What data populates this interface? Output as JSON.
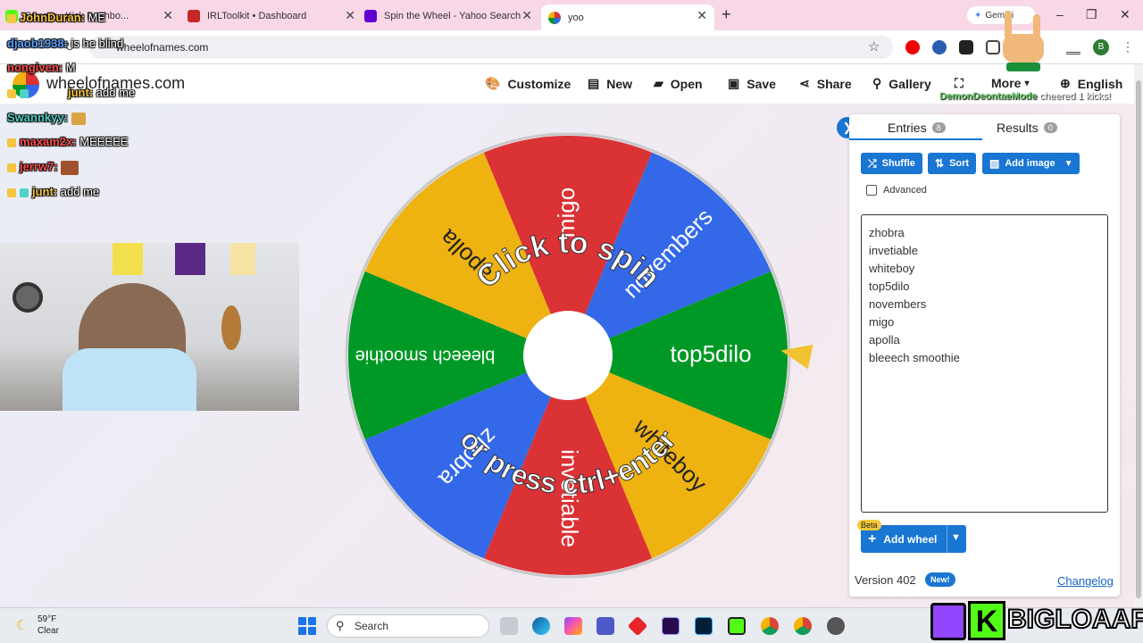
{
  "browser": {
    "tabs": [
      {
        "label": "Stream - Kick Dashbo..."
      },
      {
        "label": "IRLToolkit • Dashboard"
      },
      {
        "label": "Spin the Wheel - Yahoo Search"
      },
      {
        "label": "yoo"
      }
    ],
    "gemini_label": "Gemini",
    "url": "wheelofnames.com"
  },
  "site": {
    "name": "wheelofnames.com",
    "nav": [
      {
        "label": "Customize",
        "icon": "palette-icon"
      },
      {
        "label": "New",
        "icon": "file-icon"
      },
      {
        "label": "Open",
        "icon": "folder-icon"
      },
      {
        "label": "Save",
        "icon": "floppy-icon"
      },
      {
        "label": "Share",
        "icon": "share-icon"
      },
      {
        "label": "Gallery",
        "icon": "search-icon"
      },
      {
        "label": "More",
        "icon": "fullscreen-icon"
      },
      {
        "label": "English",
        "icon": "globe-icon"
      }
    ]
  },
  "wheel": {
    "slices": [
      "migo",
      "novembers",
      "top5dilo",
      "whiteboy",
      "invetiable",
      "zhobra",
      "bleeech smoothie",
      "apolla"
    ],
    "colors": [
      "#db3236",
      "#3369e8",
      "#009925",
      "#eeb211"
    ],
    "instruction_top": "Click to spin",
    "instruction_bottom": "or press ctrl+enter"
  },
  "panel": {
    "entries_tab": "Entries",
    "entries_count": "8",
    "results_tab": "Results",
    "results_count": "0",
    "shuffle": "Shuffle",
    "sort": "Sort",
    "add_image": "Add image",
    "advanced": "Advanced",
    "entries": [
      "zhobra",
      "invetiable",
      "whiteboy",
      "top5dilo",
      "novembers",
      "migo",
      "apolla",
      "bleeech smoothie"
    ],
    "beta": "Beta",
    "add_wheel": "Add wheel",
    "version": "Version 402",
    "new_badge": "New!",
    "changelog": "Changelog"
  },
  "chat": [
    {
      "user": "JohnDuran:",
      "msg": "ME",
      "color": "#f5c542"
    },
    {
      "user": "djaob1938:",
      "msg": "is he blind",
      "color": "#5aa0ff"
    },
    {
      "user": "nongiven:",
      "msg": "M",
      "color": "#ff4d4d"
    },
    {
      "user": "junt:",
      "msg": "add me",
      "color": "#f5c542"
    },
    {
      "user": "Swannkyy:",
      "msg": "",
      "color": "#4fd1c5"
    },
    {
      "user": "maxam2x:",
      "msg": "MEEEEE",
      "color": "#ff4d4d"
    },
    {
      "user": "jerrw7:",
      "msg": "",
      "color": "#ff4d4d"
    },
    {
      "user": "junt:",
      "msg": "add me",
      "color": "#f5c542"
    }
  ],
  "overlay": {
    "follower_user": "DemonDeontaeMode",
    "follower_text": "cheered 1 kicks!",
    "channel": "BIGLOAAF"
  },
  "taskbar": {
    "temp": "59°F",
    "condition": "Clear",
    "search": "Search"
  }
}
